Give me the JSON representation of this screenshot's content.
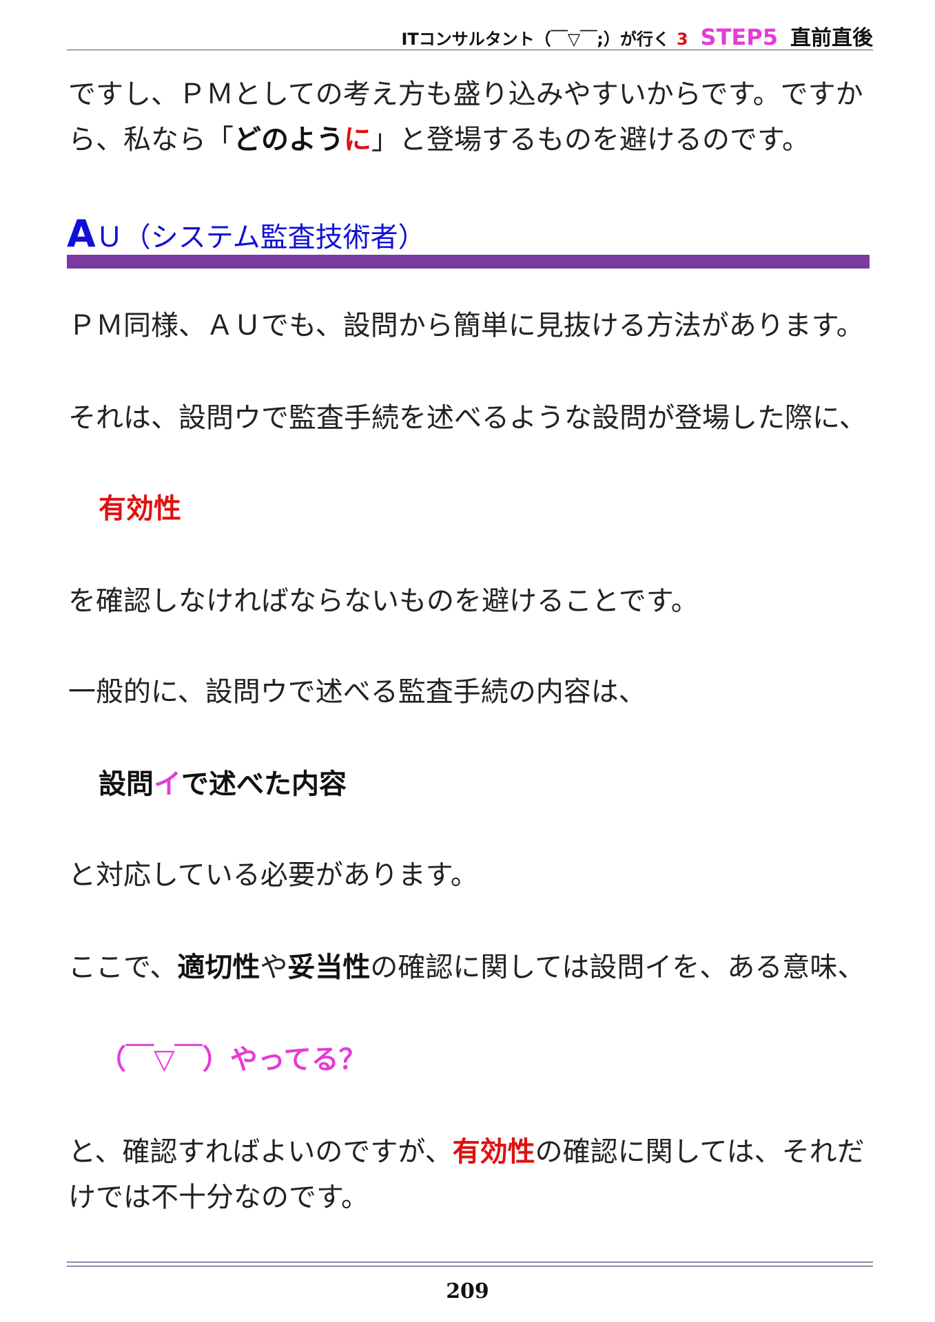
{
  "header": {
    "series": "ITコンサルタント（￣▽￣;）が行く",
    "volume": "3",
    "step": "STEP5",
    "chapter": "直前直後"
  },
  "intro": {
    "line1": "ですし、ＰＭとしての考え方も盛り込みやすいからです。ですか",
    "line2_a": "ら、私なら「",
    "line2_bold": "どのよう",
    "line2_red": "に",
    "line2_b": "」と登場するものを避けるのです。"
  },
  "section": {
    "letter": "A",
    "rest": "Ｕ（システム監査技術者）"
  },
  "paragraphs": {
    "p1": "ＰＭ同様、ＡＵでも、設問から簡単に見抜ける方法があります。",
    "p2": "それは、設問ウで監査手続を述べるような設問が登場した際に、",
    "callout1": "有効性",
    "p3": "を確認しなければならないものを避けることです。",
    "p4": "一般的に、設問ウで述べる監査手続の内容は、",
    "callout2_a": "設問",
    "callout2_mag": "イ",
    "callout2_b": "で述べた内容",
    "p5": "と対応している必要があります。",
    "p6_a": "ここで、",
    "p6_bold1": "適切性",
    "p6_b": "や",
    "p6_bold2": "妥当性",
    "p6_c": "の確認に関しては設問イを、ある意味、",
    "callout3": "（￣▽￣）やってる？",
    "p7_a": "と、確認すればよいのですが、",
    "p7_red": "有効性",
    "p7_b": "の確認に関しては、それだ",
    "p7_line2": "けでは不十分なのです。"
  },
  "page_number": "209",
  "colors": {
    "accent_red": "#e01010",
    "accent_magenta": "#e43cd6",
    "heading_blue": "#1010d8",
    "bar_purple": "#7a3aa0"
  }
}
